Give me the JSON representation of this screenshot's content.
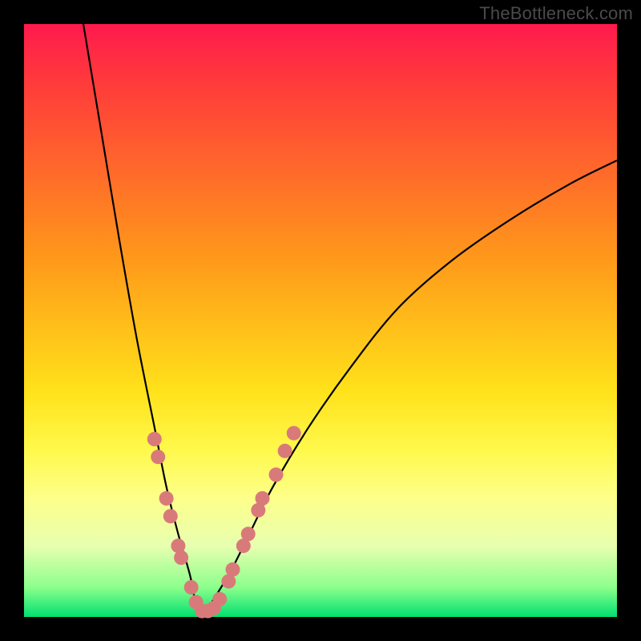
{
  "watermark": "TheBottleneck.com",
  "colors": {
    "frame": "#000000",
    "curve": "#000000",
    "marker_fill": "#d97a7a",
    "marker_stroke": "#c96a6a"
  },
  "chart_data": {
    "type": "line",
    "title": "",
    "xlabel": "",
    "ylabel": "",
    "xlim": [
      0,
      100
    ],
    "ylim": [
      0,
      100
    ],
    "note": "Axes unlabeled; gradient background from red (top, high bottleneck) to green (bottom, low bottleneck). Two black curves descend to a common minimum near x≈30, y≈0. V-shaped valley. Pink circular markers cluster on both curves near the minimum.",
    "series": [
      {
        "name": "left-curve",
        "x": [
          10,
          13,
          16,
          19,
          22,
          24,
          26,
          28,
          29,
          30
        ],
        "y": [
          100,
          82,
          64,
          47,
          32,
          22,
          14,
          7,
          2,
          0
        ]
      },
      {
        "name": "right-curve",
        "x": [
          30,
          32,
          35,
          38,
          42,
          48,
          55,
          63,
          72,
          82,
          92,
          100
        ],
        "y": [
          0,
          3,
          8,
          14,
          22,
          32,
          42,
          52,
          60,
          67,
          73,
          77
        ]
      }
    ],
    "markers": [
      {
        "x": 22.0,
        "y": 30
      },
      {
        "x": 22.6,
        "y": 27
      },
      {
        "x": 24.0,
        "y": 20
      },
      {
        "x": 24.7,
        "y": 17
      },
      {
        "x": 26.0,
        "y": 12
      },
      {
        "x": 26.5,
        "y": 10
      },
      {
        "x": 28.2,
        "y": 5
      },
      {
        "x": 29.0,
        "y": 2.5
      },
      {
        "x": 30.0,
        "y": 1
      },
      {
        "x": 31.0,
        "y": 1
      },
      {
        "x": 32.0,
        "y": 1.5
      },
      {
        "x": 33.0,
        "y": 3
      },
      {
        "x": 34.5,
        "y": 6
      },
      {
        "x": 35.2,
        "y": 8
      },
      {
        "x": 37.0,
        "y": 12
      },
      {
        "x": 37.8,
        "y": 14
      },
      {
        "x": 39.5,
        "y": 18
      },
      {
        "x": 40.2,
        "y": 20
      },
      {
        "x": 42.5,
        "y": 24
      },
      {
        "x": 44.0,
        "y": 28
      },
      {
        "x": 45.5,
        "y": 31
      }
    ]
  }
}
